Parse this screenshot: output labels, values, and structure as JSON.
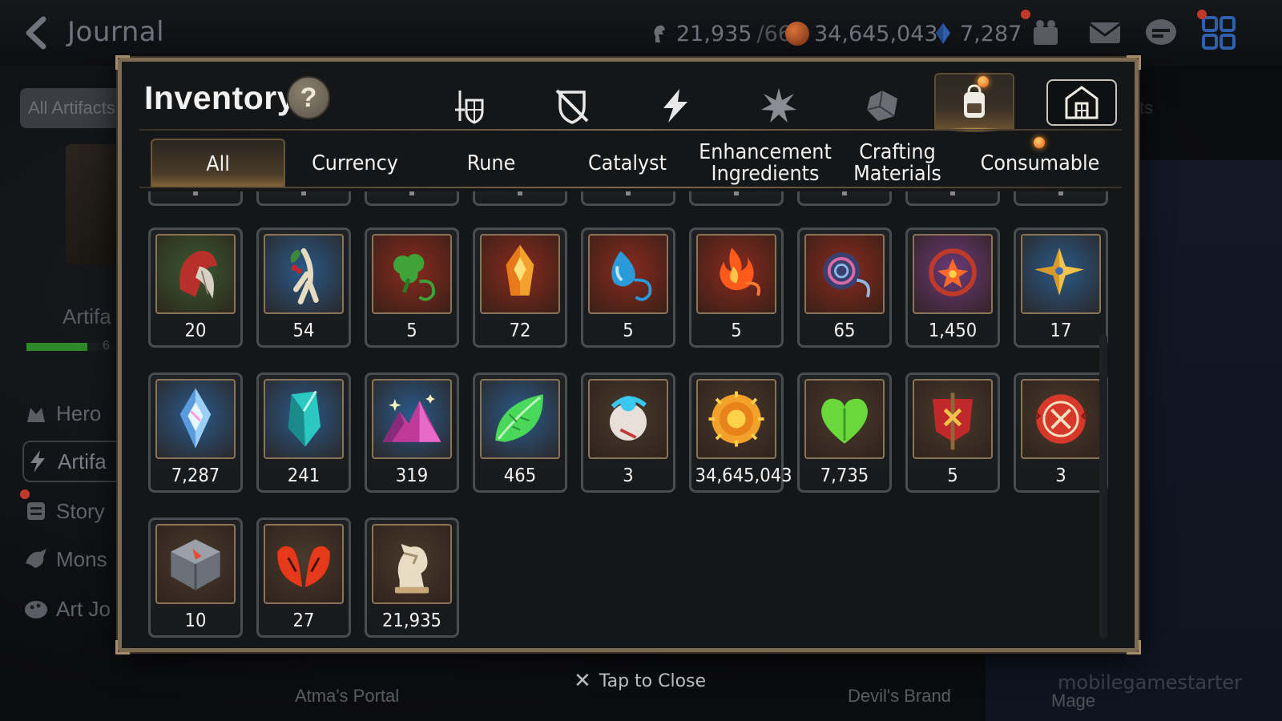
{
  "header": {
    "title": "Journal",
    "resources": [
      {
        "icon": "stamina-icon",
        "value": "21,935",
        "sub": "/66",
        "color": "#8a8f96"
      },
      {
        "icon": "gold-icon",
        "value": "34,645,043",
        "sub": "",
        "color": "#c25a2a"
      },
      {
        "icon": "crystal-icon",
        "value": "7,287",
        "sub": "",
        "color": "#3a6fc4"
      }
    ]
  },
  "background": {
    "filter_label": "All Artifacts",
    "section_title": "Artifa",
    "progress_num": "6",
    "nav_items": [
      "Hero",
      "Artifa",
      "Story",
      "Mons",
      "Art Jo"
    ],
    "bottom_labels": [
      "Atma's Portal",
      "Devil's Brand",
      "Mage"
    ],
    "right_edge_text": "ts"
  },
  "inventory": {
    "title": "Inventory",
    "help_label": "?",
    "categories": [
      {
        "name": "tab-equipment",
        "icon": "sword-shield-icon"
      },
      {
        "name": "tab-no-equip",
        "icon": "crossed-shield-icon"
      },
      {
        "name": "tab-artifact",
        "icon": "lightning-icon"
      },
      {
        "name": "tab-memory",
        "icon": "burst-icon"
      },
      {
        "name": "tab-material",
        "icon": "cube-icon"
      },
      {
        "name": "tab-bag",
        "icon": "backpack-icon"
      },
      {
        "name": "tab-storage",
        "icon": "storehouse-icon"
      }
    ],
    "active_category": 5,
    "subtabs": [
      "All",
      "Currency",
      "Rune",
      "Catalyst",
      "Enhancement Ingredients",
      "Crafting Materials",
      "Consumable"
    ],
    "active_subtab": 0,
    "items": [
      {
        "icon": "claw-icon",
        "qty": "20",
        "frame": "#3a5a35"
      },
      {
        "icon": "ginseng-icon",
        "qty": "54",
        "frame": "#2a5a8a"
      },
      {
        "icon": "clover-rune-icon",
        "qty": "5",
        "frame": "#8a2a1e"
      },
      {
        "icon": "flame-crystal-icon",
        "qty": "72",
        "frame": "#8a2a1e"
      },
      {
        "icon": "water-rune-icon",
        "qty": "5",
        "frame": "#8a2a1e"
      },
      {
        "icon": "fire-rune-icon",
        "qty": "5",
        "frame": "#8a2a1e"
      },
      {
        "icon": "vortex-rune-icon",
        "qty": "65",
        "frame": "#8a2a1e"
      },
      {
        "icon": "flower-rune-icon",
        "qty": "1,450",
        "frame": "#6a3a7a"
      },
      {
        "icon": "star-rune-icon",
        "qty": "17",
        "frame": "#2a5a8a"
      },
      {
        "icon": "crystal-shard-icon",
        "qty": "7,287",
        "frame": "#2a5a8a"
      },
      {
        "icon": "emerald-crystal-icon",
        "qty": "241",
        "frame": "#2a5a8a"
      },
      {
        "icon": "gem-mountain-icon",
        "qty": "319",
        "frame": "#2a5a8a"
      },
      {
        "icon": "leaf-icon",
        "qty": "465",
        "frame": "#2a5a8a"
      },
      {
        "icon": "scroll-orb-icon",
        "qty": "3",
        "frame": "#4a3a2e"
      },
      {
        "icon": "gold-coin-icon",
        "qty": "34,645,043",
        "frame": "#4a3a2e"
      },
      {
        "icon": "green-heart-icon",
        "qty": "7,735",
        "frame": "#4a3a2e"
      },
      {
        "icon": "banner-icon",
        "qty": "5",
        "frame": "#4a3a2e"
      },
      {
        "icon": "seal-icon",
        "qty": "3",
        "frame": "#4a3a2e"
      },
      {
        "icon": "stone-block-icon",
        "qty": "10",
        "frame": "#4a3a2e"
      },
      {
        "icon": "red-wings-icon",
        "qty": "27",
        "frame": "#4a3a2e"
      },
      {
        "icon": "chess-knight-icon",
        "qty": "21,935",
        "frame": "#4a3a2e"
      }
    ]
  },
  "close_hint": "Tap to Close",
  "watermark": "mobilegamestarter"
}
